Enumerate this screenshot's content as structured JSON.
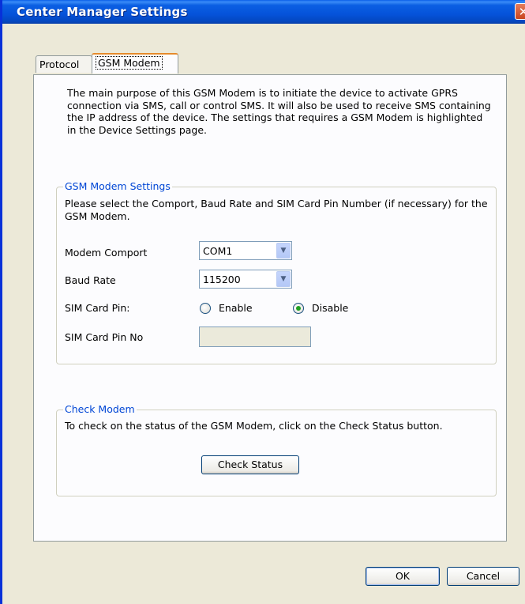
{
  "window": {
    "title": "Center Manager Settings",
    "close_glyph": "✕"
  },
  "tabs": [
    {
      "label": "Protocol",
      "active": false
    },
    {
      "label": "GSM Modem",
      "active": true
    }
  ],
  "description": "The main purpose of this GSM Modem is to initiate the device to activate GPRS connection via SMS, call or control SMS. It will also be used to receive SMS containing the IP address of the device. The settings that requires a GSM Modem is highlighted in the Device Settings page.",
  "gsm_settings": {
    "legend": "GSM Modem Settings",
    "instructions": "Please select the Comport, Baud Rate and SIM Card Pin Number (if necessary) for the GSM Modem.",
    "modem_comport_label": "Modem Comport",
    "modem_comport_value": "COM1",
    "baud_rate_label": "Baud Rate",
    "baud_rate_value": "115200",
    "sim_card_pin_label": "SIM Card Pin:",
    "enable_label": "Enable",
    "disable_label": "Disable",
    "selected_option": "Disable",
    "sim_pin_no_label": "SIM Card Pin No",
    "sim_pin_no_value": ""
  },
  "check_modem": {
    "legend": "Check Modem",
    "instructions": "To check on the status of the GSM Modem, click on the Check Status button.",
    "button_label": "Check Status"
  },
  "footer": {
    "ok_label": "OK",
    "cancel_label": "Cancel"
  },
  "colors": {
    "titlebar": "#0553DA",
    "dialog_bg": "#ECE9D8",
    "group_legend": "#0046D5",
    "active_tab_accent": "#E68B2C"
  }
}
